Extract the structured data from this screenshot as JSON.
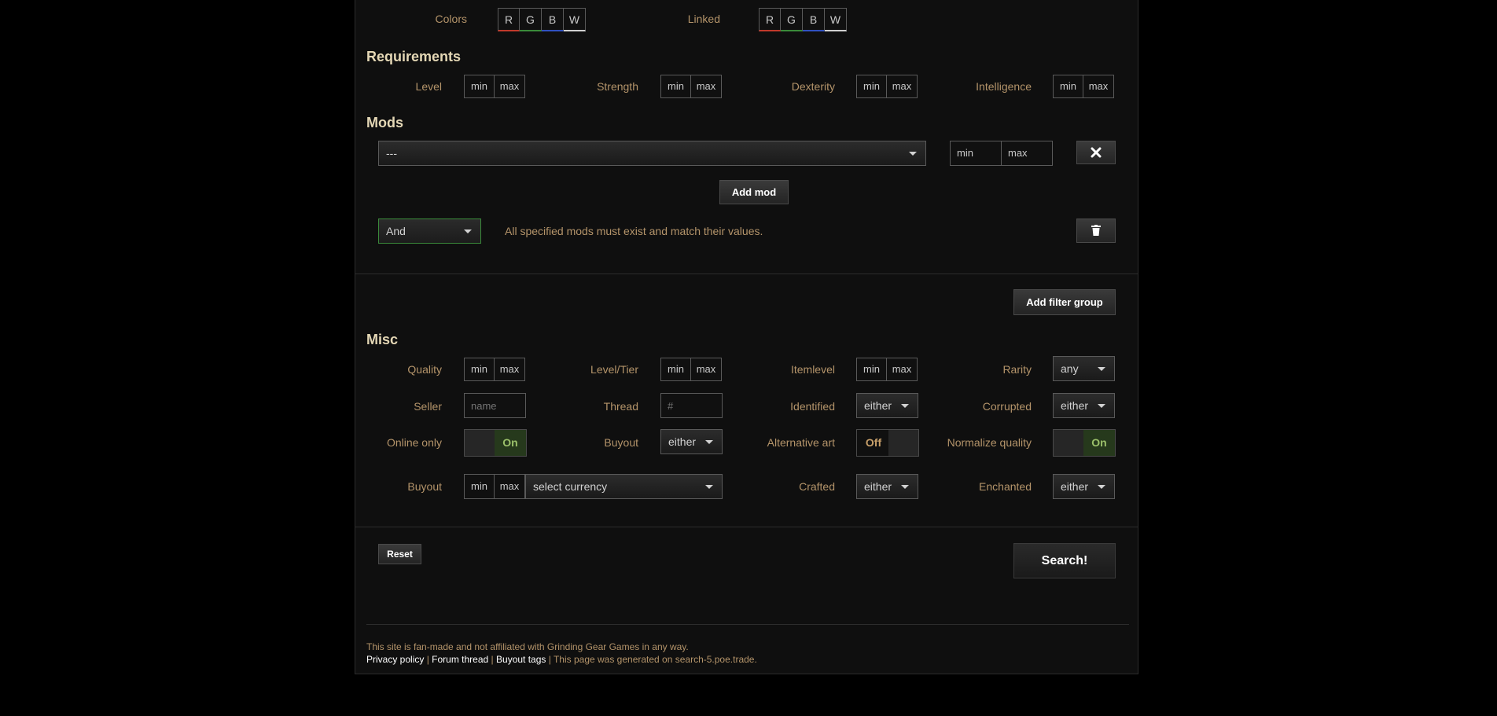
{
  "sockets": {
    "colors_label": "Colors",
    "linked_label": "Linked",
    "letters": [
      "R",
      "G",
      "B",
      "W"
    ],
    "letter_colors": [
      "#c0392b",
      "#3a8a3a",
      "#3050c0",
      "#d0d0d0"
    ]
  },
  "requirements": {
    "heading": "Requirements",
    "fields": [
      {
        "label": "Level",
        "min": "min",
        "max": "max"
      },
      {
        "label": "Strength",
        "min": "min",
        "max": "max"
      },
      {
        "label": "Dexterity",
        "min": "min",
        "max": "max"
      },
      {
        "label": "Intelligence",
        "min": "min",
        "max": "max"
      }
    ]
  },
  "mods": {
    "heading": "Mods",
    "mod_select_value": "---",
    "min": "min",
    "max": "max",
    "remove_icon": "close-icon",
    "add_mod_label": "Add mod",
    "group_type": "And",
    "group_description": "All specified mods must exist and match their values.",
    "delete_icon": "trash-icon",
    "add_filter_group_label": "Add filter group"
  },
  "misc": {
    "heading": "Misc",
    "quality": {
      "label": "Quality",
      "min": "min",
      "max": "max"
    },
    "level_tier": {
      "label": "Level/Tier",
      "min": "min",
      "max": "max"
    },
    "itemlevel": {
      "label": "Itemlevel",
      "min": "min",
      "max": "max"
    },
    "rarity": {
      "label": "Rarity",
      "value": "any"
    },
    "seller": {
      "label": "Seller",
      "placeholder": "name"
    },
    "thread": {
      "label": "Thread",
      "placeholder": "#"
    },
    "identified": {
      "label": "Identified",
      "value": "either"
    },
    "corrupted": {
      "label": "Corrupted",
      "value": "either"
    },
    "online_only": {
      "label": "Online only",
      "state": "On"
    },
    "buyout_select": {
      "label": "Buyout",
      "value": "either"
    },
    "alternative_art": {
      "label": "Alternative art",
      "state": "Off"
    },
    "normalize_quality": {
      "label": "Normalize quality",
      "state": "On"
    },
    "buyout_range": {
      "label": "Buyout",
      "min": "min",
      "max": "max",
      "currency": "select currency"
    },
    "crafted": {
      "label": "Crafted",
      "value": "either"
    },
    "enchanted": {
      "label": "Enchanted",
      "value": "either"
    }
  },
  "actions": {
    "reset_label": "Reset",
    "search_label": "Search!"
  },
  "footer": {
    "disclaimer": "This site is fan-made and not affiliated with Grinding Gear Games in any way.",
    "privacy": "Privacy policy",
    "sep": "|",
    "forum": "Forum thread",
    "buyout_tags": "Buyout tags",
    "generated": "| This page was generated on search-5.poe.trade."
  },
  "colors": {
    "accent": "#c8a06a",
    "heading": "#e4d7b5",
    "toggle_on": "#9bc06a",
    "group_border": "#3a8a3a"
  }
}
